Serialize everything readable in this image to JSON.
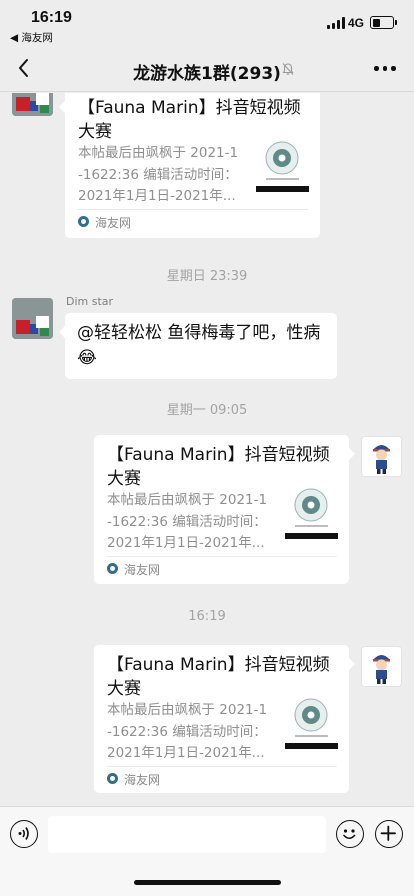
{
  "status_bar": {
    "time": "16:19",
    "back_app": "◀ 海友网",
    "network": "4G"
  },
  "nav": {
    "title": "龙游水族1群(293)"
  },
  "messages": [
    {
      "type": "link_card",
      "title": "【Fauna Marin】抖音短视频大赛",
      "description_lines": [
        "本帖最后由飒枫于 2021-1",
        "-1622:36 编辑活动时间：",
        "2021年1月1日-2021年..."
      ],
      "source": "海友网"
    },
    {
      "type": "timestamp",
      "text": "星期日 23:39"
    },
    {
      "type": "text",
      "sender": "Dim  star",
      "text": "@轻轻松松 鱼得梅毒了吧，性病",
      "emoji": "😂"
    },
    {
      "type": "timestamp",
      "text": "星期一 09:05"
    },
    {
      "type": "link_card",
      "title": "【Fauna Marin】抖音短视频大赛",
      "description_lines": [
        "本帖最后由飒枫于 2021-1",
        "-1622:36 编辑活动时间：",
        "2021年1月1日-2021年..."
      ],
      "source": "海友网"
    },
    {
      "type": "timestamp",
      "text": "16:19"
    },
    {
      "type": "link_card",
      "title": "【Fauna Marin】抖音短视频大赛",
      "description_lines": [
        "本帖最后由飒枫于 2021-1",
        "-1622:36 编辑活动时间：",
        "2021年1月1日-2021年..."
      ],
      "source": "海友网"
    }
  ],
  "input": {
    "value": ""
  }
}
